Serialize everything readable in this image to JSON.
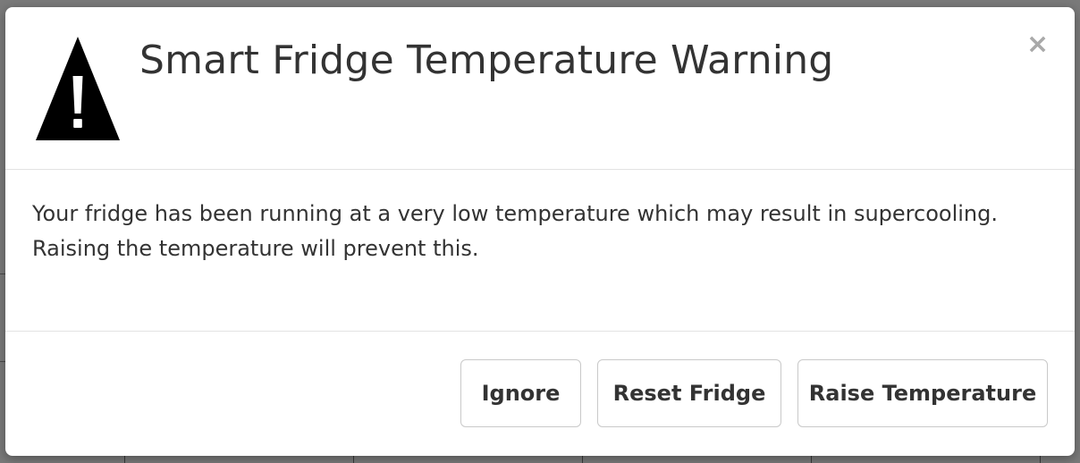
{
  "modal": {
    "title": "Smart Fridge Temperature Warning",
    "close_label": "×",
    "icon": "warning-triangle-icon",
    "message_line1": "Your fridge has been running at a very low temperature which may result in supercooling.",
    "message_line2": "Raising the temperature will prevent this."
  },
  "footer": {
    "ignore_label": "Ignore",
    "reset_label": "Reset Fridge",
    "raise_label": "Raise Temperature"
  },
  "colors": {
    "overlay": "#7a7a7a",
    "modal_background": "#ffffff",
    "text": "#333333",
    "button_border": "#c9c9c9",
    "close_icon": "#a9a9a9"
  }
}
